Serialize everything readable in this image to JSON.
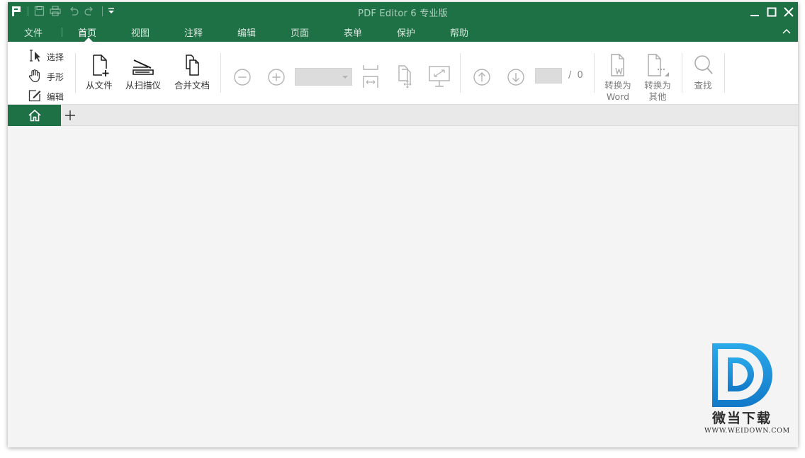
{
  "window": {
    "title": "PDF Editor 6 专业版"
  },
  "menu": {
    "items": [
      {
        "label": "文件"
      },
      {
        "label": "首页"
      },
      {
        "label": "视图"
      },
      {
        "label": "注释"
      },
      {
        "label": "编辑"
      },
      {
        "label": "页面"
      },
      {
        "label": "表单"
      },
      {
        "label": "保护"
      },
      {
        "label": "帮助"
      }
    ],
    "active": "首页"
  },
  "ribbon": {
    "modes": {
      "select": "选择",
      "hand": "手形",
      "edit": "编辑"
    },
    "create": {
      "from_file": "从文件",
      "from_scanner": "从扫描仪",
      "combine": "合并文档"
    },
    "zoom": {
      "value": ""
    },
    "navigation": {
      "current_page": "",
      "total_pages": "/ 0"
    },
    "convert": {
      "to_word_line1": "转换为",
      "to_word_line2": "Word",
      "to_other_line1": "转换为",
      "to_other_line2": "其他"
    },
    "find": "查找"
  },
  "watermark": {
    "name": "微当下载",
    "url": "WWW.WEIDOWN.COM"
  },
  "colors": {
    "brand_green": "#1e7145",
    "watermark_blue": "#2196e0"
  }
}
